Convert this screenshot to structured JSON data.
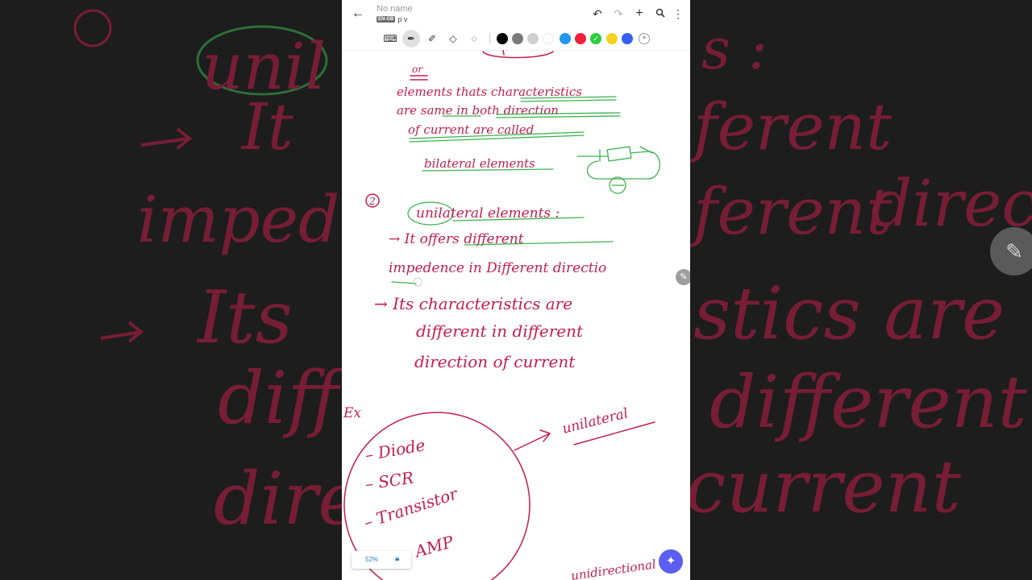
{
  "app": {
    "title": "No name",
    "lang_tag": "EN-GB",
    "subtitle": "p v"
  },
  "toolbar": {
    "back_icon": "arrow-left-icon",
    "undo_icon": "undo-icon",
    "redo_icon": "redo-icon",
    "add_icon": "plus-icon",
    "search_icon": "search-icon",
    "more_icon": "more-vert-icon"
  },
  "tools": [
    "keyboard-icon",
    "pen-icon",
    "highlighter-icon",
    "eraser-icon",
    "lasso-icon"
  ],
  "colors": [
    "#000000",
    "#7a7a7a",
    "#cfcfcf",
    "#ffffff",
    "#2196f3",
    "#f0203c",
    "#2ecc40",
    "#f5d020",
    "#3560f0"
  ],
  "notes": {
    "or": "or",
    "line1": "elements thats characteristics",
    "line2": "are same in both direction",
    "line3": "of current are called",
    "line4": "bilateral elements",
    "num2": "2",
    "heading": "unilateral elements :",
    "b1a": "→ It offers different",
    "b1b": "impedence in Different directio",
    "b2a": "→ Its characteristics are",
    "b2b": "different in different",
    "b2c": "direction of current",
    "ex": "Ex",
    "item1": "– Diode",
    "item2": "– SCR",
    "item3": "– Transistor",
    "item4": "– OP - AMP",
    "label": "unilateral",
    "bottom_partial": "unidirectional"
  },
  "zoom": "52%",
  "fab_icon": "sparkle-icon",
  "edge_icon": "pencil-icon",
  "background": {
    "b1": "unil",
    "b2": "It",
    "b3": "impedence",
    "b4": "Its",
    "b5": "diff",
    "b6": "direc",
    "r1": "s :",
    "r2": "ferent",
    "r3": "direction",
    "r4": "stics are",
    "r5": "different",
    "r6": "current"
  }
}
